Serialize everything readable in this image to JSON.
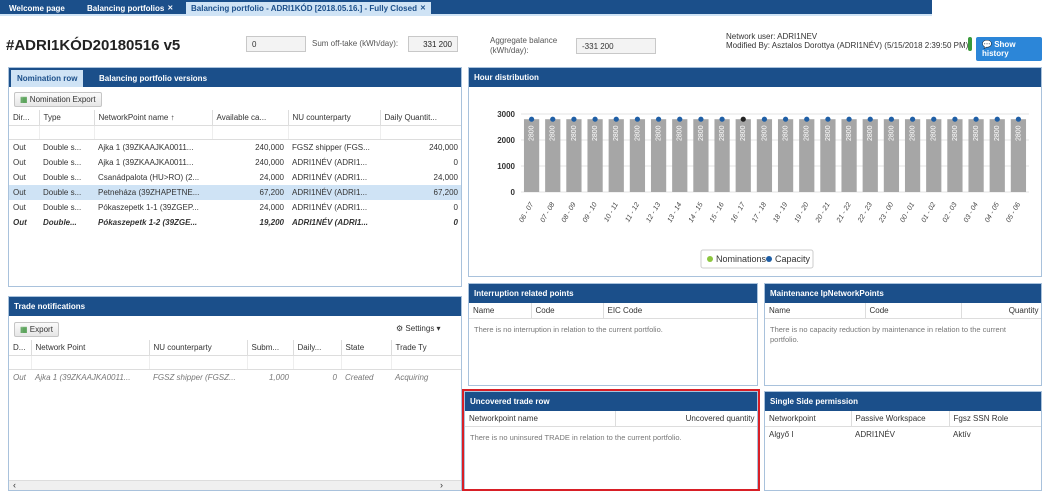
{
  "tabs": [
    {
      "label": "Welcome page"
    },
    {
      "label": "Balancing portfolios"
    },
    {
      "label": "Balancing portfolio - ADRI1KÓD [2018.05.16.] - Fully Closed"
    }
  ],
  "header": {
    "title": "#ADRI1KÓD20180516 v5",
    "field1": "0",
    "sum_label": "Sum off-take (kWh/day):",
    "sum_value": "331 200",
    "agg_label": "Aggregate balance (kWh/day):",
    "agg_value": "-331 200",
    "network_user": "Network user: ADRI1NEV",
    "modified_by": "Modified By: Asztalos Dorottya (ADRI1NÉV) (5/15/2018 2:39:50 PM)",
    "show_history": "Show history"
  },
  "nomination": {
    "tab1": "Nomination row",
    "tab2": "Balancing portfolio versions",
    "export": "Nomination Export",
    "columns": [
      "Dir...",
      "Type",
      "NetworkPoint name ↑",
      "Available ca...",
      "NU counterparty",
      "Daily Quantit..."
    ],
    "rows": [
      [
        "Out",
        "Double s...",
        "Ajka 1 (39ZKAAJKA0011...",
        "240,000",
        "FGSZ shipper (FGS...",
        "240,000"
      ],
      [
        "Out",
        "Double s...",
        "Ajka 1 (39ZKAAJKA0011...",
        "240,000",
        "ADRI1NÉV (ADRI1...",
        "0"
      ],
      [
        "Out",
        "Double s...",
        "Csanádpalota (HU>RO) (2...",
        "24,000",
        "ADRI1NÉV (ADRI1...",
        "24,000"
      ],
      [
        "Out",
        "Double s...",
        "Petneháza (39ZHAPETNE...",
        "67,200",
        "ADRI1NÉV (ADRI1...",
        "67,200"
      ],
      [
        "Out",
        "Double s...",
        "Pókaszepetk 1-1 (39ZGEP...",
        "24,000",
        "ADRI1NÉV (ADRI1...",
        "0"
      ],
      [
        "Out",
        "Double...",
        "Pókaszepetk 1-2 (39ZGE...",
        "19,200",
        "ADRI1NÉV (ADRI1...",
        "0"
      ]
    ]
  },
  "trade": {
    "title": "Trade notifications",
    "export": "Export",
    "settings": "Settings",
    "columns": [
      "D...",
      "Network Point",
      "NU counterparty",
      "Subm...",
      "Daily...",
      "State",
      "Trade Ty"
    ],
    "rows": [
      [
        "Out",
        "Ajka 1 (39ZKAAJKA0011...",
        "FGSZ shipper (FGSZ...",
        "1,000",
        "0",
        "Created",
        "Acquiring"
      ]
    ]
  },
  "hour": {
    "title": "Hour distribution",
    "legend_nom": "Nominations",
    "legend_cap": "Capacity"
  },
  "chart_data": {
    "type": "bar",
    "categories": [
      "06 - 07",
      "07 - 08",
      "08 - 09",
      "09 - 10",
      "10 - 11",
      "11 - 12",
      "12 - 13",
      "13 - 14",
      "14 - 15",
      "15 - 16",
      "16 - 17",
      "17 - 18",
      "18 - 19",
      "19 - 20",
      "20 - 21",
      "21 - 22",
      "22 - 23",
      "23 - 00",
      "00 - 01",
      "01 - 02",
      "02 - 03",
      "03 - 04",
      "04 - 05",
      "05 - 06"
    ],
    "series": [
      {
        "name": "Nominations",
        "values": [
          2800,
          2800,
          2800,
          2800,
          2800,
          2800,
          2800,
          2800,
          2800,
          2800,
          2800,
          2800,
          2800,
          2800,
          2800,
          2800,
          2800,
          2800,
          2800,
          2800,
          2800,
          2800,
          2800,
          2800
        ]
      },
      {
        "name": "Capacity",
        "values": [
          2800,
          2800,
          2800,
          2800,
          2800,
          2800,
          2800,
          2800,
          2800,
          2800,
          2800,
          2800,
          2800,
          2800,
          2800,
          2800,
          2800,
          2800,
          2800,
          2800,
          2800,
          2800,
          2800,
          2800
        ]
      }
    ],
    "yticks": [
      0,
      1000,
      2000,
      3000
    ],
    "ylim": [
      0,
      3000
    ],
    "bar_color": "#a6a6a6",
    "nom_color": "#8dc63f",
    "cap_color": "#1f5fa6"
  },
  "interruption": {
    "title": "Interruption related points",
    "columns": [
      "Name",
      "Code",
      "EIC Code"
    ],
    "message": "There is no interruption in relation to the current portfolio."
  },
  "maintenance": {
    "title": "Maintenance IpNetworkPoints",
    "columns": [
      "Name",
      "Code",
      "Quantity"
    ],
    "message": "There is no capacity reduction by maintenance in relation to the current portfolio."
  },
  "uncovered": {
    "title": "Uncovered trade row",
    "columns": [
      "Networkpoint name",
      "Uncovered quantity"
    ],
    "message": "There is no uninsured TRADE in relation to the current portfolio."
  },
  "single": {
    "title": "Single Side permission",
    "columns": [
      "Networkpoint",
      "Passive Workspace",
      "Fgsz SSN Role"
    ],
    "rows": [
      [
        "Algyő I",
        "ADRI1NÉV",
        "Aktív"
      ]
    ]
  }
}
